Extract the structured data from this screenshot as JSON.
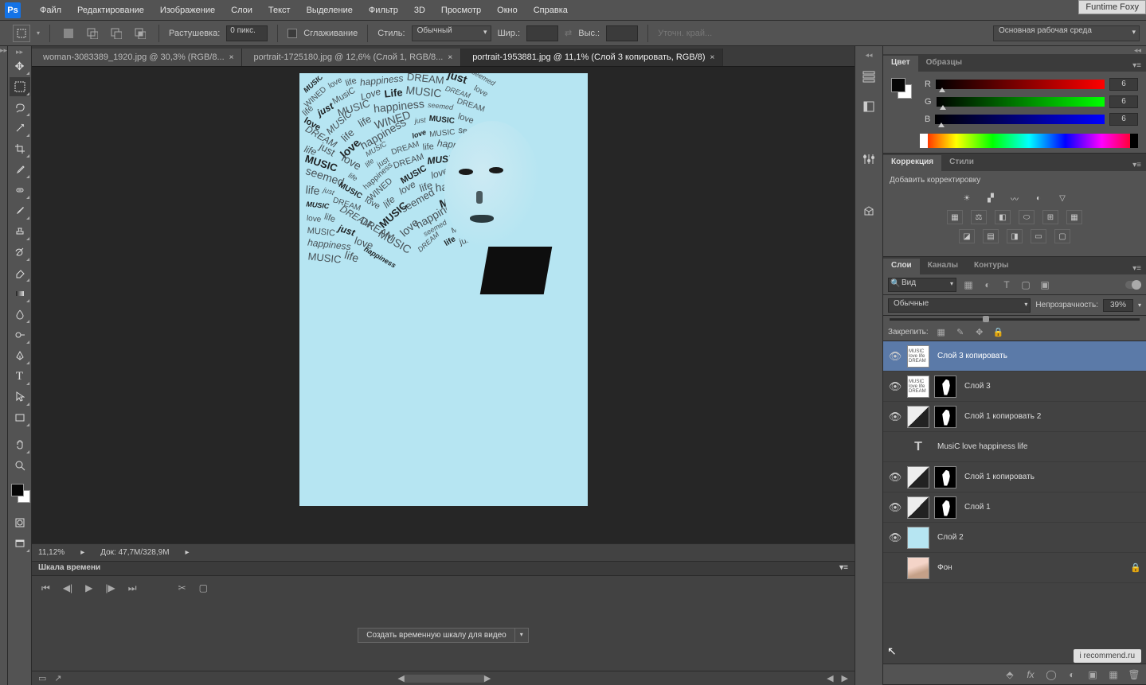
{
  "app": {
    "logo": "Ps",
    "tag": "Funtime Foxy"
  },
  "menu": [
    "Файл",
    "Редактирование",
    "Изображение",
    "Слои",
    "Текст",
    "Выделение",
    "Фильтр",
    "3D",
    "Просмотр",
    "Окно",
    "Справка"
  ],
  "options": {
    "feather_lbl": "Растушевка:",
    "feather_val": "0 пикс.",
    "antialias": "Сглаживание",
    "style_lbl": "Стиль:",
    "style_val": "Обычный",
    "width_lbl": "Шир.:",
    "height_lbl": "Выс.:",
    "refine": "Уточн. край...",
    "workspace": "Основная рабочая среда"
  },
  "tabs": [
    {
      "label": "woman-3083389_1920.jpg @ 30,3% (RGB/8...",
      "active": false
    },
    {
      "label": "portrait-1725180.jpg @ 12,6% (Слой 1, RGB/8...",
      "active": false
    },
    {
      "label": "portrait-1953881.jpg @ 11,1% (Слой 3 копировать, RGB/8)",
      "active": true
    }
  ],
  "status": {
    "zoom": "11,12%",
    "doc": "Док: 47,7M/328,9M"
  },
  "timeline": {
    "title": "Шкала времени",
    "btn": "Создать временную шкалу для видео"
  },
  "color": {
    "tab1": "Цвет",
    "tab2": "Образцы",
    "r_lbl": "R",
    "g_lbl": "G",
    "b_lbl": "B",
    "r": "6",
    "g": "6",
    "b": "6"
  },
  "adjust": {
    "tab1": "Коррекция",
    "tab2": "Стили",
    "title": "Добавить корректировку"
  },
  "layersPanel": {
    "tab1": "Слои",
    "tab2": "Каналы",
    "tab3": "Контуры",
    "kind": "Вид",
    "blend": "Обычные",
    "opacity_lbl": "Непрозрачность:",
    "opacity": "39%",
    "lock_lbl": "Закрепить:"
  },
  "layers": [
    {
      "vis": true,
      "name": "Слой 3 копировать",
      "sel": true,
      "thumbs": [
        "txtw"
      ]
    },
    {
      "vis": true,
      "name": "Слой 3",
      "thumbs": [
        "txtw",
        "mask"
      ]
    },
    {
      "vis": true,
      "name": "Слой 1 копировать 2",
      "thumbs": [
        "bw",
        "mask"
      ]
    },
    {
      "vis": false,
      "name": "MusiC    love    happiness    life",
      "thumbs": [
        "T"
      ]
    },
    {
      "vis": true,
      "name": "Слой 1 копировать",
      "thumbs": [
        "bw",
        "mask"
      ]
    },
    {
      "vis": true,
      "name": "Слой 1",
      "thumbs": [
        "bw",
        "mask"
      ]
    },
    {
      "vis": true,
      "name": "Слой 2",
      "thumbs": [
        "blue"
      ]
    },
    {
      "vis": false,
      "name": "Фон",
      "locked": true,
      "thumbs": [
        "photo"
      ]
    }
  ],
  "watermark": "i recommend.ru",
  "canvas_words": [
    "MUSIC",
    "love",
    "life",
    "happiness",
    "DREAM",
    "just",
    "seemed",
    "WINED",
    "MusiC",
    "Love",
    "Life",
    "MUSIC",
    "DREAM",
    "love",
    "life",
    "just",
    "MUSIC",
    "happiness",
    "seemed",
    "DREAM",
    "love",
    "MUSIC",
    "life",
    "WINED",
    "just",
    "MUSIC",
    "love",
    "DREAM",
    "life",
    "happiness",
    "love",
    "MUSIC",
    "seemed",
    "life",
    "just",
    "love",
    "MUSIC",
    "DREAM",
    "life",
    "happiness",
    "MUSIC",
    "love",
    "life",
    "just",
    "DREAM",
    "MUSIC",
    "love",
    "seemed",
    "life",
    "happiness",
    "MUSIC",
    "love",
    "DREAM",
    "life",
    "just",
    "MUSIC",
    "WINED",
    "love",
    "life",
    "happiness",
    "MUSIC",
    "DREAM",
    "love",
    "life",
    "seemed",
    "MUSIC",
    "just",
    "love",
    "life",
    "DREAM",
    "MUSIC",
    "happiness",
    "love",
    "life",
    "MUSIC",
    "just",
    "DREAM",
    "love",
    "seemed",
    "MUSIC",
    "life",
    "happiness",
    "love",
    "MUSIC",
    "DREAM",
    "life",
    "just",
    "love",
    "MUSIC",
    "life",
    "happiness"
  ]
}
